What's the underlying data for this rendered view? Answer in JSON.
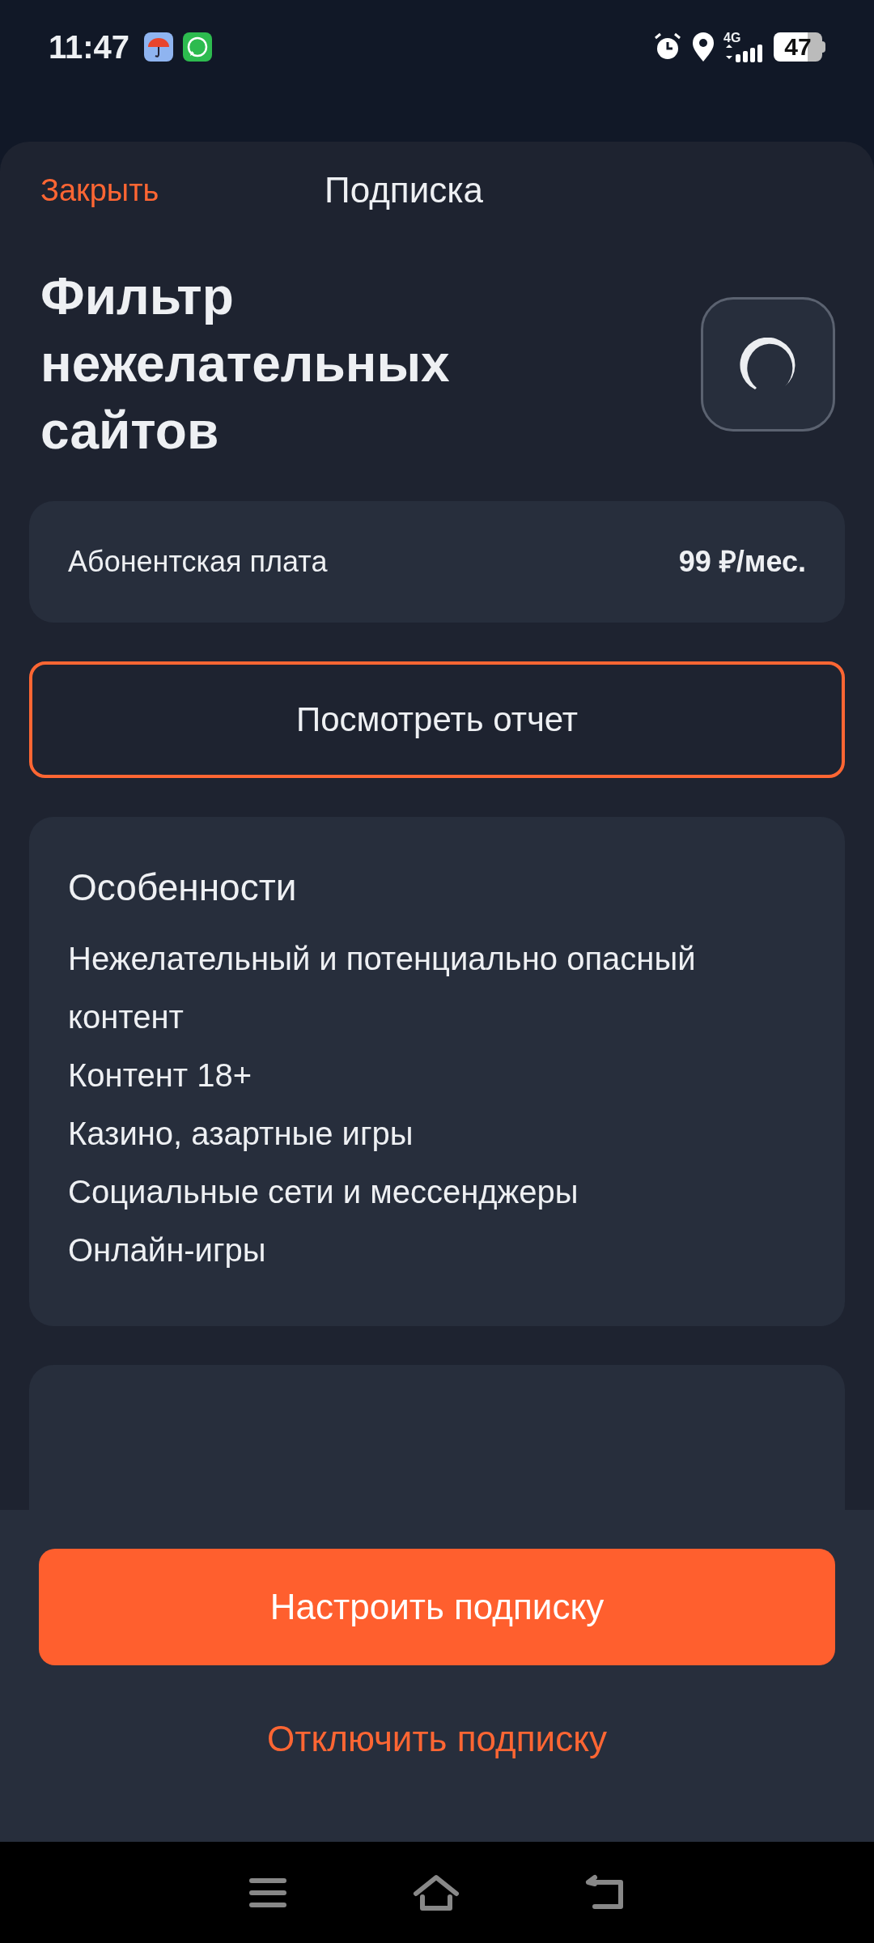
{
  "status_bar": {
    "time": "11:47",
    "network": "4G",
    "battery": "47"
  },
  "header": {
    "close": "Закрыть",
    "title": "Подписка"
  },
  "service": {
    "title": "Фильтр нежелательных сайтов"
  },
  "fee": {
    "label": "Абонентская плата",
    "value": "99 ₽/мес."
  },
  "report_button": "Посмотреть отчет",
  "features": {
    "title": "Особенности",
    "items": [
      "Нежелательный и потенциально опасный контент",
      "Контент 18+",
      "Казино, азартные игры",
      "Социальные сети и мессенджеры",
      "Онлайн-игры"
    ]
  },
  "actions": {
    "primary": "Настроить подписку",
    "secondary": "Отключить подписку"
  }
}
